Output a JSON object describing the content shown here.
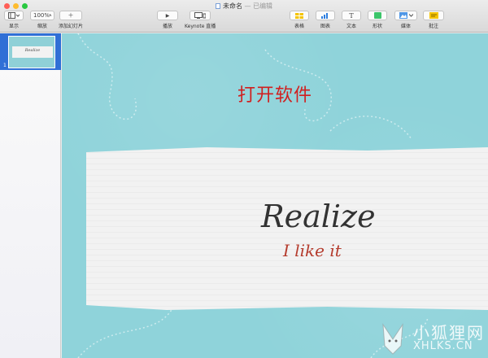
{
  "window": {
    "title": "未命名",
    "subtitle": "— 已编辑",
    "controls": [
      "close-icon",
      "minimize-icon",
      "zoom-icon"
    ]
  },
  "toolbar": {
    "view_label": "显示",
    "zoom_value": "100%",
    "zoom_label": "缩放",
    "add_slide_label": "添加幻灯片",
    "play_label": "播放",
    "keynote_live_label": "Keynote 直播",
    "table_label": "表格",
    "chart_label": "图表",
    "text_label": "文本",
    "shape_label": "形状",
    "media_label": "媒体",
    "comment_label": "批注",
    "text_glyph": "T",
    "add_glyph": "＋",
    "play_glyph": "▶"
  },
  "sidebar": {
    "slides": [
      {
        "number": "1",
        "thumb_text": "Realize"
      }
    ]
  },
  "slide": {
    "heading": "打开软件",
    "title": "Realize",
    "subtitle": "I  like it"
  },
  "watermark": {
    "text_cn": "小狐狸网",
    "text_en": "XHLKS.CN"
  },
  "colors": {
    "canvas_bg": "#8fd3da",
    "heading": "#d11f1f",
    "subtitle": "#b53c2e",
    "selection": "#2f6fd6"
  }
}
